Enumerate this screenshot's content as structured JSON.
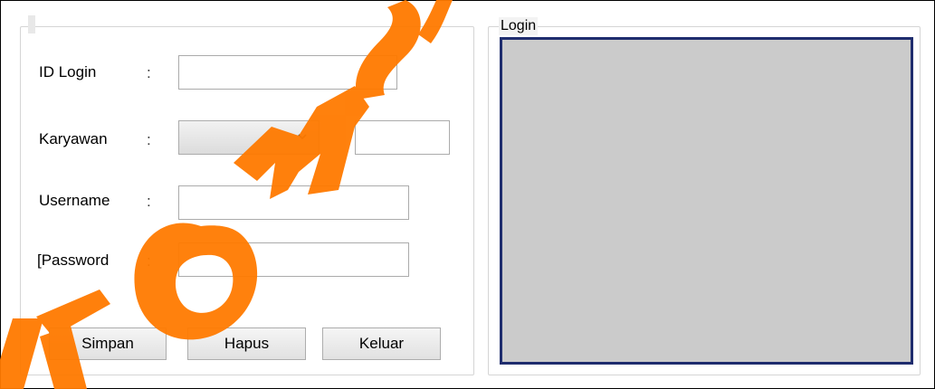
{
  "form": {
    "id_login_label": "ID Login",
    "karyawan_label": "Karyawan",
    "username_label": "Username",
    "password_label": "[Password",
    "colon": ":",
    "id_login_value": "",
    "karyawan_selected": "",
    "karyawan_name_value": "",
    "username_value": "",
    "password_value": ""
  },
  "buttons": {
    "simpan": "Simpan",
    "hapus": "Hapus",
    "keluar": "Keluar"
  },
  "login_panel": {
    "title": "Login"
  },
  "colors": {
    "grid_border": "#1f2d6e",
    "grid_background": "#cbcbcb",
    "watermark": "#ff7a00"
  },
  "watermark": {
    "text": "KOMS",
    "color": "#ff7a00"
  }
}
